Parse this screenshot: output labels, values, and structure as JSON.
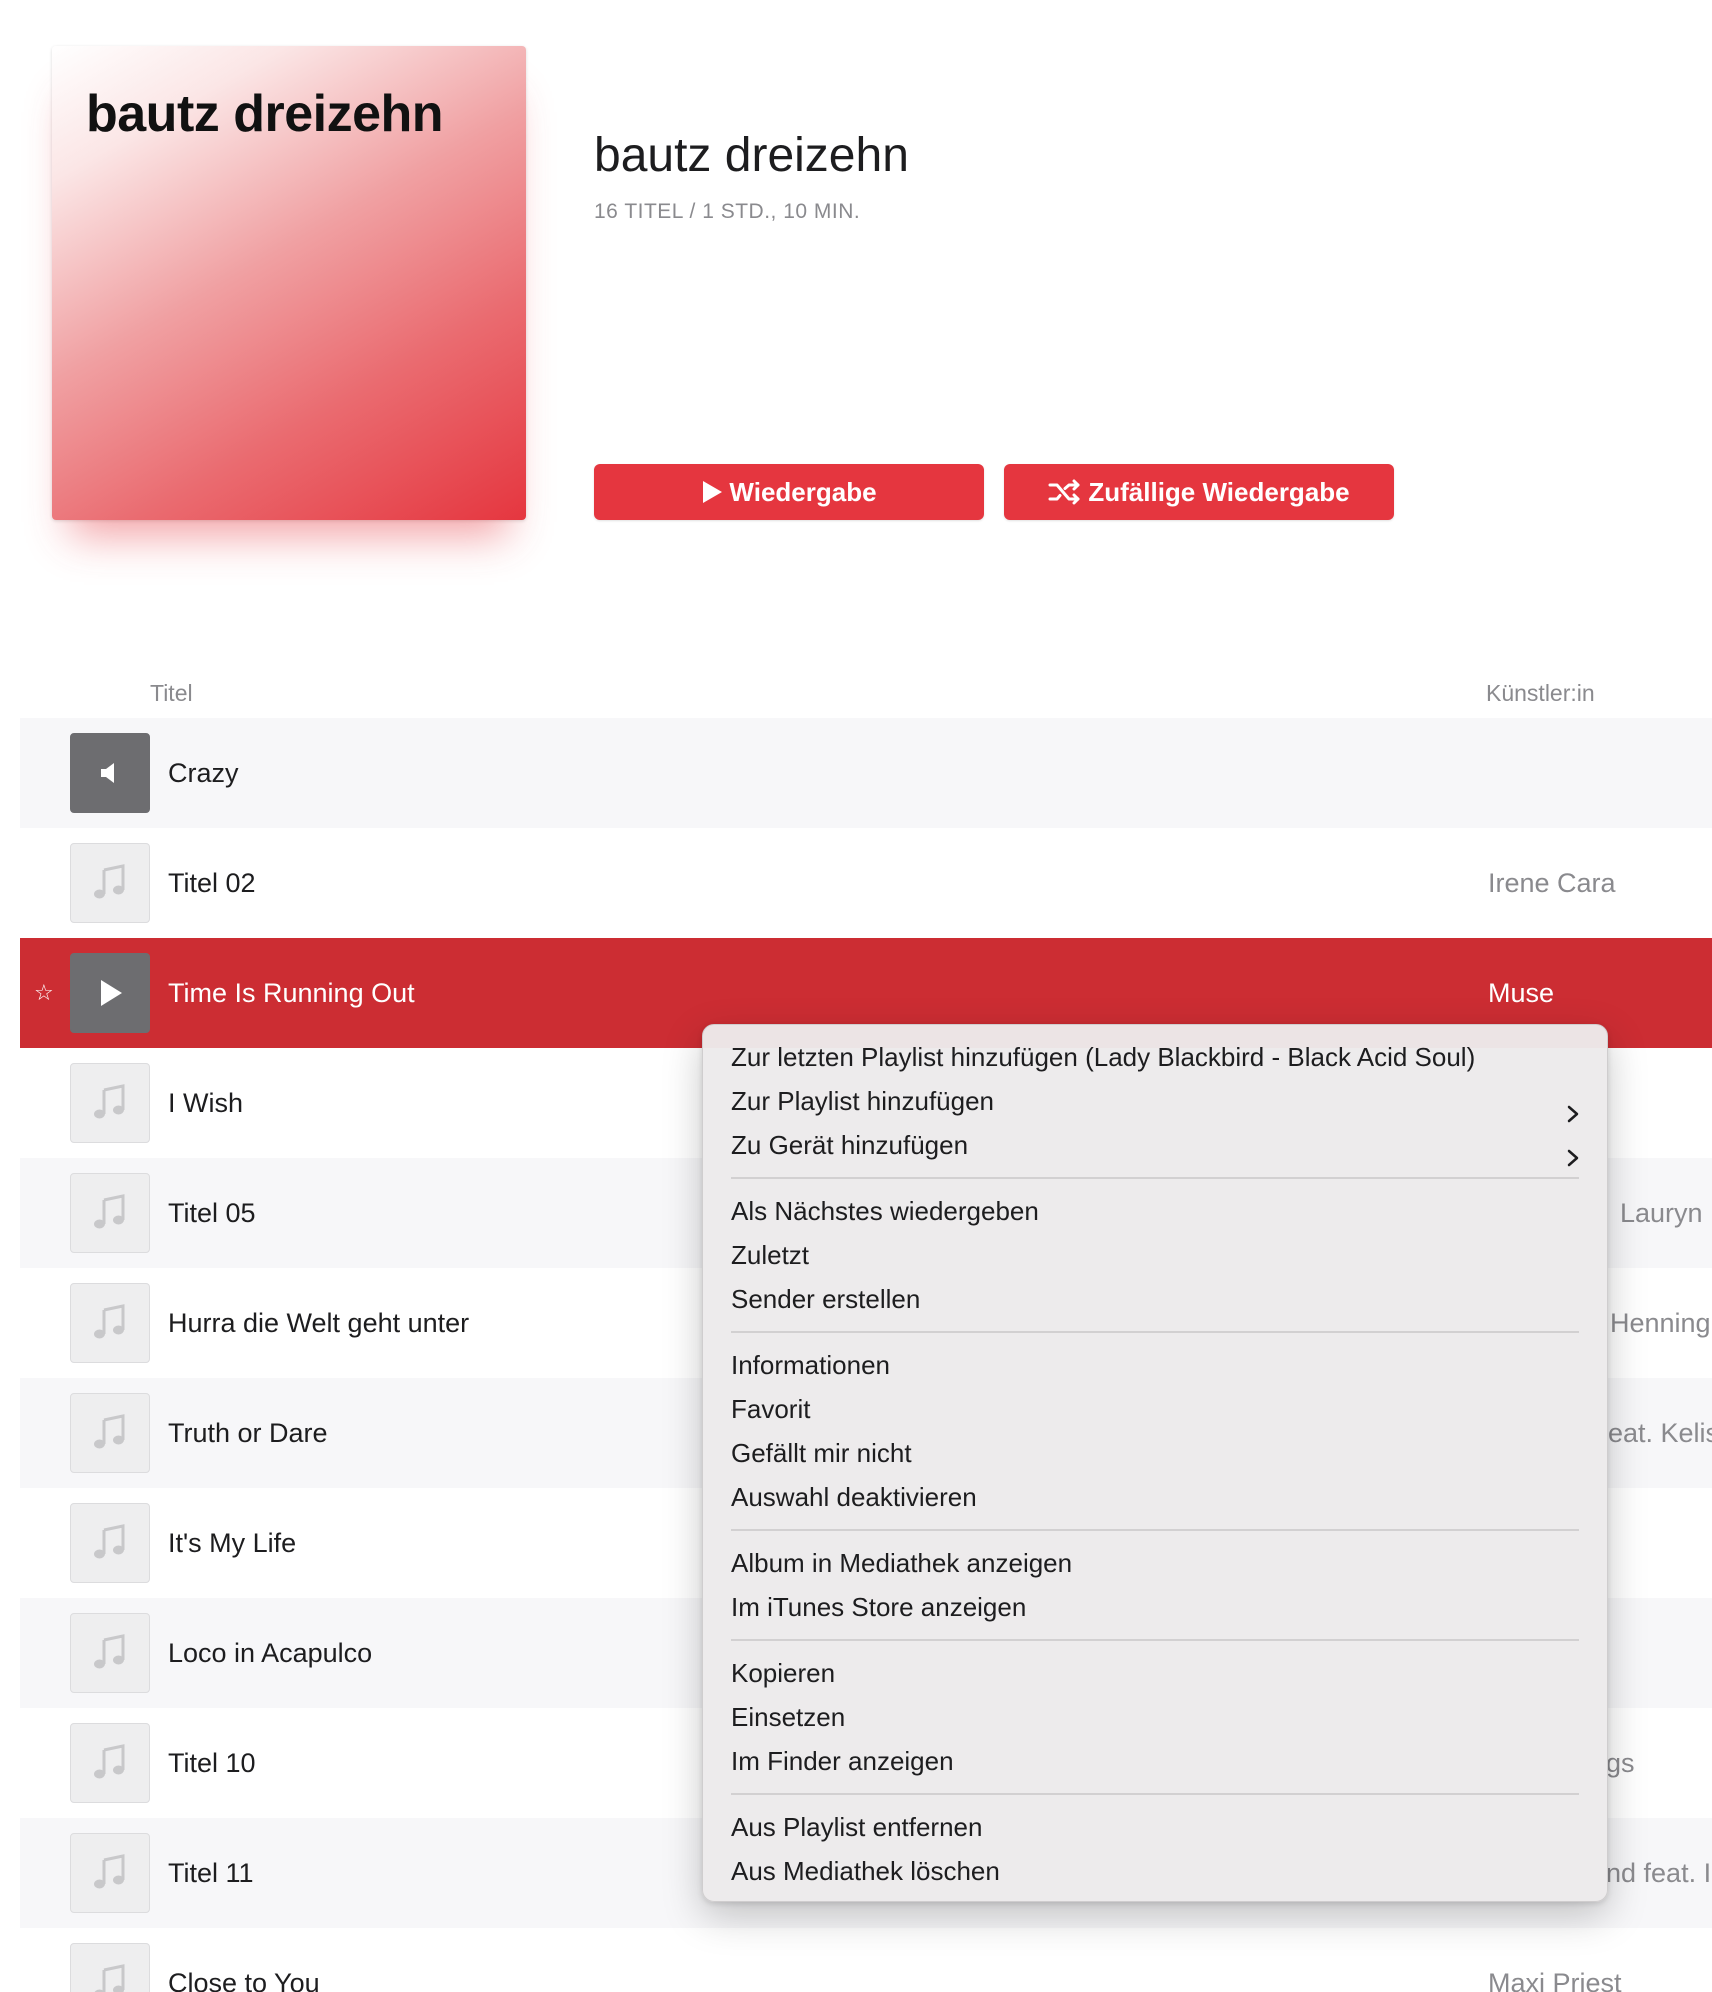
{
  "header": {
    "artwork_text": "bautz dreizehn",
    "title": "bautz dreizehn",
    "meta": "16 TITEL / 1 STD., 10 MIN.",
    "play_label": "Wiedergabe",
    "shuffle_label": "Zufällige Wiedergabe"
  },
  "table": {
    "col_title": "Titel",
    "col_artist": "Künstler:in"
  },
  "tracks": [
    {
      "title": "Crazy",
      "artist": ""
    },
    {
      "title": "Titel 02",
      "artist": "Irene Cara"
    },
    {
      "title": "Time Is Running Out",
      "artist": "Muse"
    },
    {
      "title": "I Wish",
      "artist": ""
    },
    {
      "title": "Titel 05",
      "artist": "Lauryn H"
    },
    {
      "title": "Hurra die Welt geht unter",
      "artist": "Henning"
    },
    {
      "title": "Truth or Dare",
      "artist": "eat. Kelis"
    },
    {
      "title": "It's My Life",
      "artist": ""
    },
    {
      "title": "Loco in Acapulco",
      "artist": ""
    },
    {
      "title": "Titel 10",
      "artist": "gs"
    },
    {
      "title": "Titel 11",
      "artist": "nd feat. I"
    },
    {
      "title": "Close to You",
      "artist": "Maxi Priest"
    }
  ],
  "context_menu": {
    "group1": [
      "Zur letzten Playlist hinzufügen (Lady Blackbird - Black Acid Soul)",
      "Zur Playlist hinzufügen",
      "Zu Gerät hinzufügen"
    ],
    "group2": [
      "Als Nächstes wiedergeben",
      "Zuletzt",
      "Sender erstellen"
    ],
    "group3": [
      "Informationen",
      "Favorit",
      "Gefällt mir nicht",
      "Auswahl deaktivieren"
    ],
    "group4": [
      "Album in Mediathek anzeigen",
      "Im iTunes Store anzeigen"
    ],
    "group5": [
      "Kopieren",
      "Einsetzen",
      "Im Finder anzeigen"
    ],
    "group6": [
      "Aus Playlist entfernen",
      "Aus Mediathek löschen"
    ]
  },
  "icons": {
    "play": "play-icon",
    "shuffle": "shuffle-icon",
    "music_note": "music-note-icon",
    "speaker": "speaker-icon",
    "star": "star-icon",
    "chevron": "chevron-right-icon"
  },
  "colors": {
    "accent": "#e5363f",
    "selected_row": "#cc2d33"
  }
}
